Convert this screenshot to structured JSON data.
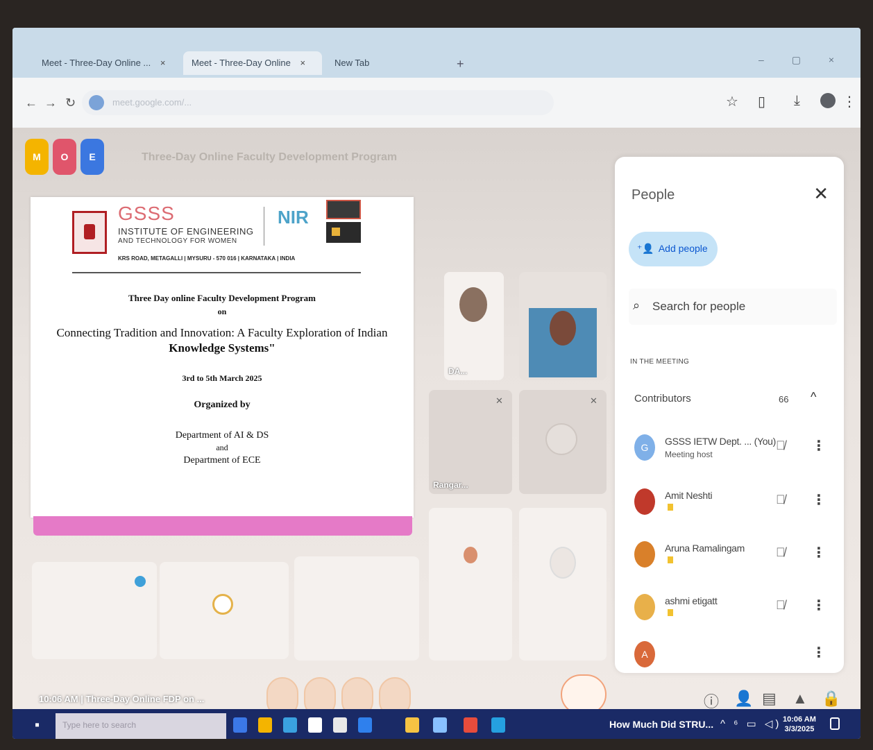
{
  "browser": {
    "tabs": [
      {
        "label": "Meet - Three-Day Online ..."
      },
      {
        "label": "Meet - Three-Day Online"
      },
      {
        "label": "New Tab"
      }
    ],
    "close_glyph": "×",
    "new_tab_glyph": "+",
    "window_controls": "– ▢ ×",
    "nav": {
      "back": "←",
      "forward": "→",
      "reload": "↻"
    },
    "url": "meet.google.com/...",
    "toolbar_icons": {
      "bookmark": "☆",
      "sidebar": "▯",
      "download": "⤓",
      "menu": "⋮"
    }
  },
  "meet": {
    "title": "Three-Day Online Faculty Development Program",
    "app_icons": [
      {
        "name": "meet-app",
        "glyph": "M",
        "color": "#f4b400"
      },
      {
        "name": "chrome-app",
        "glyph": "O",
        "color": "#e0556b"
      },
      {
        "name": "docs-app",
        "glyph": "E",
        "color": "#3b77e0"
      }
    ]
  },
  "slide": {
    "gsss": "GSSS",
    "institute_line1": "INSTITUTE OF ENGINEERING",
    "institute_line2": "AND TECHNOLOGY FOR WOMEN",
    "address": "KRS ROAD, METAGALLI | MYSURU - 570 016 | KARNATAKA | INDIA",
    "nirf": "NIR",
    "fdp": "Three Day online Faculty Development Program",
    "on": "on",
    "title_line1": "Connecting Tradition and Innovation: A Faculty Exploration of Indian",
    "title_line2": "Knowledge Systems\"",
    "date": "3rd to 5th March 2025",
    "organized_by": "Organized by",
    "dept1": "Department of AI & DS",
    "and": "and",
    "dept2": "Department of ECE"
  },
  "tiles": [
    {
      "name": "DA..."
    },
    {
      "name": ""
    },
    {
      "name": "Rangar..."
    },
    {
      "name": ""
    }
  ],
  "people_panel": {
    "title": "People",
    "close_glyph": "✕",
    "add_people": "Add people",
    "add_icon": "⁺👤",
    "search_icon": "⌕",
    "search_placeholder": "Search for people",
    "section_label": "IN THE MEETING",
    "group_label": "Contributors",
    "group_count": "66",
    "chevron": "^",
    "participants": [
      {
        "name": "GSSS IETW Dept. ... (You)",
        "subtitle": "Meeting host",
        "avatar_color": "#7fb0e8",
        "avatar_letter": "G"
      },
      {
        "name": "Amit Neshti",
        "subtitle": "",
        "avatar_color": "#c0392b",
        "avatar_letter": ""
      },
      {
        "name": "Aruna Ramalingam",
        "subtitle": "",
        "avatar_color": "#d9802a",
        "avatar_letter": ""
      },
      {
        "name": "ashmi etigatt",
        "subtitle": "",
        "avatar_color": "#e8b04a",
        "avatar_letter": ""
      },
      {
        "name": "",
        "subtitle": "",
        "avatar_color": "#d9693a",
        "avatar_letter": "A"
      }
    ],
    "mic_off_glyph": "🎙̸",
    "more_glyph": "⋮"
  },
  "bottom_bar": {
    "time_and_title": "10:06 AM | Three-Day Online FDP on ..."
  },
  "taskbar": {
    "search_placeholder": "Type here to search",
    "notification": "How Much Did STRU...",
    "system_tray": "^ ⁶ ▭ ◁)",
    "time": "10:06 AM",
    "date": "3/3/2025",
    "app_colors": [
      "#3b78e7",
      "#f4b400",
      "#3aa1e0",
      "#ffffff",
      "#e8e8e8",
      "#2f80ed",
      "#f6c343",
      "#88c0ff",
      "#e74c3c",
      "#25a0e0"
    ]
  }
}
